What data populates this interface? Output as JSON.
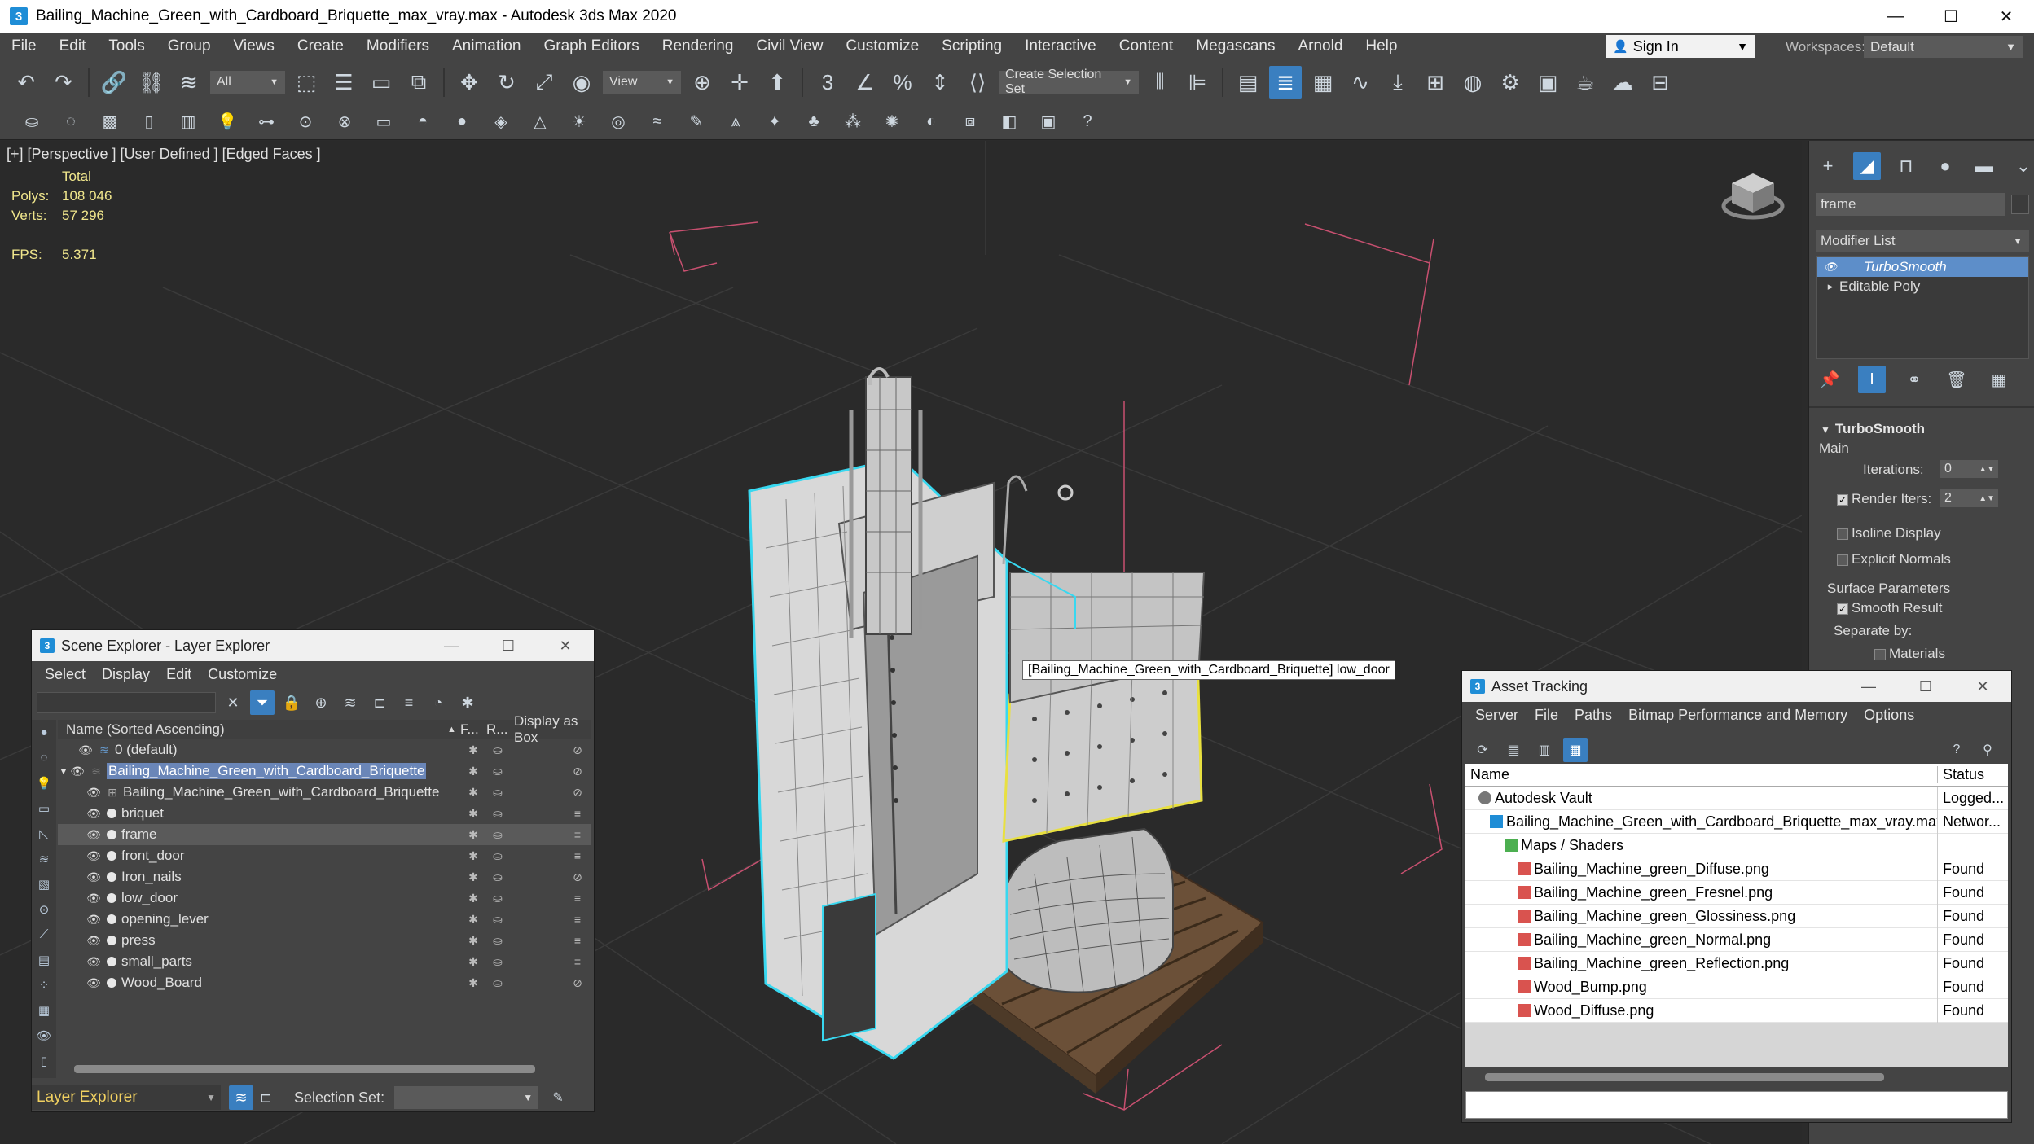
{
  "window": {
    "title": "Bailing_Machine_Green_with_Cardboard_Briquette_max_vray.max - Autodesk 3ds Max 2020",
    "app_icon": "3",
    "minimize": "—",
    "maximize": "☐",
    "close": "✕"
  },
  "menu": [
    "File",
    "Edit",
    "Tools",
    "Group",
    "Views",
    "Create",
    "Modifiers",
    "Animation",
    "Graph Editors",
    "Rendering",
    "Civil View",
    "Customize",
    "Scripting",
    "Interactive",
    "Content",
    "Megascans",
    "Arnold",
    "Help"
  ],
  "signin": {
    "label": "Sign In"
  },
  "workspaces": {
    "label": "Workspaces:",
    "value": "Default"
  },
  "toolbar": {
    "filter": "All",
    "ref_coord": "View",
    "selection_set": "Create Selection Set"
  },
  "viewport": {
    "label": "[+] [Perspective ] [User Defined ] [Edged Faces ]",
    "stats": {
      "total_label": "Total",
      "polys_label": "Polys:",
      "polys": "108 046",
      "verts_label": "Verts:",
      "verts": "57 296",
      "fps_label": "FPS:",
      "fps": "5.371"
    },
    "tooltip": "[Bailing_Machine_Green_with_Cardboard_Briquette] low_door"
  },
  "command_panel": {
    "object_name": "frame",
    "modifier_list": "Modifier List",
    "stack": [
      "TurboSmooth",
      "Editable Poly"
    ],
    "rollout": {
      "title": "TurboSmooth",
      "main": "Main",
      "iterations_label": "Iterations:",
      "iterations": "0",
      "render_iters_label": "Render Iters:",
      "render_iters": "2",
      "isoline": "Isoline Display",
      "explicit": "Explicit Normals",
      "surface": "Surface Parameters",
      "smooth": "Smooth Result",
      "separate": "Separate by:",
      "materials": "Materials"
    }
  },
  "scene_explorer": {
    "title": "Scene Explorer - Layer Explorer",
    "menu": [
      "Select",
      "Display",
      "Edit",
      "Customize"
    ],
    "columns": {
      "name": "Name (Sorted Ascending)",
      "f": "F...",
      "r": "R...",
      "box": "Display as Box"
    },
    "rows": [
      {
        "name": "0 (default)",
        "kind": "layer",
        "indent": 0
      },
      {
        "name": "Bailing_Machine_Green_with_Cardboard_Briquette",
        "kind": "layer",
        "indent": 0,
        "selected": true
      },
      {
        "name": "Bailing_Machine_Green_with_Cardboard_Briquette",
        "kind": "group",
        "indent": 1
      },
      {
        "name": "briquet",
        "kind": "object",
        "indent": 1
      },
      {
        "name": "frame",
        "kind": "object",
        "indent": 1,
        "highlight": true
      },
      {
        "name": "front_door",
        "kind": "object",
        "indent": 1
      },
      {
        "name": "Iron_nails",
        "kind": "object",
        "indent": 1
      },
      {
        "name": "low_door",
        "kind": "object",
        "indent": 1
      },
      {
        "name": "opening_lever",
        "kind": "object",
        "indent": 1
      },
      {
        "name": "press",
        "kind": "object",
        "indent": 1
      },
      {
        "name": "small_parts",
        "kind": "object",
        "indent": 1
      },
      {
        "name": "Wood_Board",
        "kind": "object",
        "indent": 1
      }
    ],
    "layer_explorer": "Layer Explorer",
    "selection_set_label": "Selection Set:"
  },
  "asset_tracking": {
    "title": "Asset Tracking",
    "menu": [
      "Server",
      "File",
      "Paths",
      "Bitmap Performance and Memory",
      "Options"
    ],
    "columns": {
      "name": "Name",
      "status": "Status"
    },
    "rows": [
      {
        "name": "Autodesk Vault",
        "status": "Logged...",
        "icon": "vault",
        "indent": 1
      },
      {
        "name": "Bailing_Machine_Green_with_Cardboard_Briquette_max_vray.max",
        "status": "Networ...",
        "icon": "max",
        "indent": 2
      },
      {
        "name": "Maps / Shaders",
        "status": "",
        "icon": "folder",
        "indent": 3
      },
      {
        "name": "Bailing_Machine_green_Diffuse.png",
        "status": "Found",
        "icon": "png",
        "indent": 4
      },
      {
        "name": "Bailing_Machine_green_Fresnel.png",
        "status": "Found",
        "icon": "png",
        "indent": 4
      },
      {
        "name": "Bailing_Machine_green_Glossiness.png",
        "status": "Found",
        "icon": "png",
        "indent": 4
      },
      {
        "name": "Bailing_Machine_green_Normal.png",
        "status": "Found",
        "icon": "png",
        "indent": 4
      },
      {
        "name": "Bailing_Machine_green_Reflection.png",
        "status": "Found",
        "icon": "png",
        "indent": 4
      },
      {
        "name": "Wood_Bump.png",
        "status": "Found",
        "icon": "png",
        "indent": 4
      },
      {
        "name": "Wood_Diffuse.png",
        "status": "Found",
        "icon": "png",
        "indent": 4
      }
    ]
  },
  "colors": {
    "stats_yellow": "#f0e68c",
    "selection_blue": "#5d8ec9",
    "wire_cyan": "#38d8f0",
    "wire_yellow": "#e8e040",
    "bbox_pink": "#e06080"
  }
}
